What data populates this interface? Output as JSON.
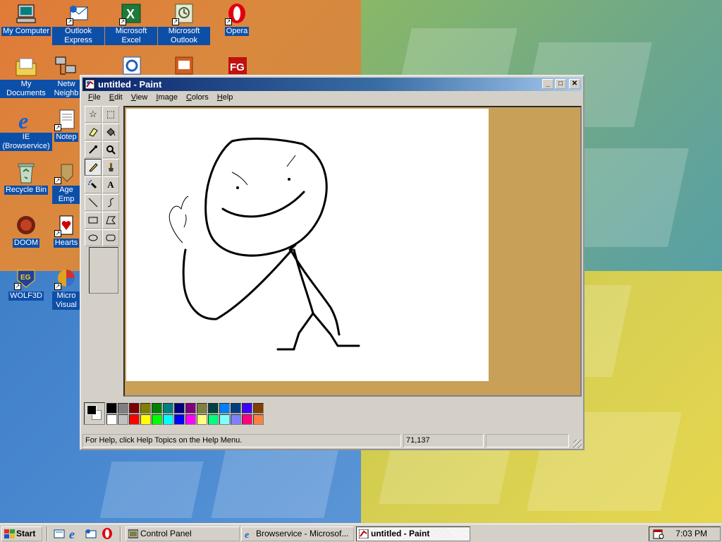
{
  "desktop": {
    "icons": [
      {
        "name": "my-computer",
        "label": "My Computer"
      },
      {
        "name": "outlook-express",
        "label": "Outlook Express"
      },
      {
        "name": "microsoft-excel",
        "label": "Microsoft Excel"
      },
      {
        "name": "microsoft-outlook",
        "label": "Microsoft Outlook"
      },
      {
        "name": "opera",
        "label": "Opera"
      },
      {
        "name": "my-documents",
        "label": "My Documents"
      },
      {
        "name": "network-neighborhood",
        "label": "Netw Neighb"
      },
      {
        "name": "ie-browservice",
        "label": "IE (Browservice)"
      },
      {
        "name": "notepad",
        "label": "Notep"
      },
      {
        "name": "recycle-bin",
        "label": "Recycle Bin"
      },
      {
        "name": "age-of-empires",
        "label": "Age Emp"
      },
      {
        "name": "doom",
        "label": "DOOM"
      },
      {
        "name": "hearts",
        "label": "Hearts"
      },
      {
        "name": "wolf3d",
        "label": "WOLF3D"
      },
      {
        "name": "microsoft-visual",
        "label": "Micro Visual"
      }
    ]
  },
  "window": {
    "title": "untitled - Paint",
    "menu": [
      "File",
      "Edit",
      "View",
      "Image",
      "Colors",
      "Help"
    ],
    "menu_mnemonics": [
      "F",
      "E",
      "V",
      "I",
      "C",
      "H"
    ],
    "tools": [
      "free-form-select",
      "select",
      "eraser",
      "fill-with-color",
      "pick-color",
      "magnifier",
      "pencil",
      "brush",
      "airbrush",
      "text",
      "line",
      "curve",
      "rectangle",
      "polygon",
      "ellipse",
      "rounded-rectangle"
    ],
    "active_tool": "pencil",
    "palette": {
      "foreground": "#000000",
      "background": "#ffffff",
      "colors": [
        "#000000",
        "#808080",
        "#800000",
        "#808000",
        "#008000",
        "#008080",
        "#000080",
        "#800080",
        "#808040",
        "#004040",
        "#0080ff",
        "#004080",
        "#4000ff",
        "#804000",
        "#ffffff",
        "#c0c0c0",
        "#ff0000",
        "#ffff00",
        "#00ff00",
        "#00ffff",
        "#0000ff",
        "#ff00ff",
        "#ffff80",
        "#00ff80",
        "#80ffff",
        "#8080ff",
        "#ff0080",
        "#ff8040"
      ]
    },
    "status": {
      "help": "For Help, click Help Topics on the Help Menu.",
      "coords": "71,137",
      "size": ""
    }
  },
  "taskbar": {
    "start_label": "Start",
    "tasks": [
      {
        "label": "Control Panel",
        "active": false
      },
      {
        "label": "Browservice - Microsof...",
        "active": false
      },
      {
        "label": "untitled - Paint",
        "active": true
      }
    ],
    "clock": "7:03 PM"
  }
}
